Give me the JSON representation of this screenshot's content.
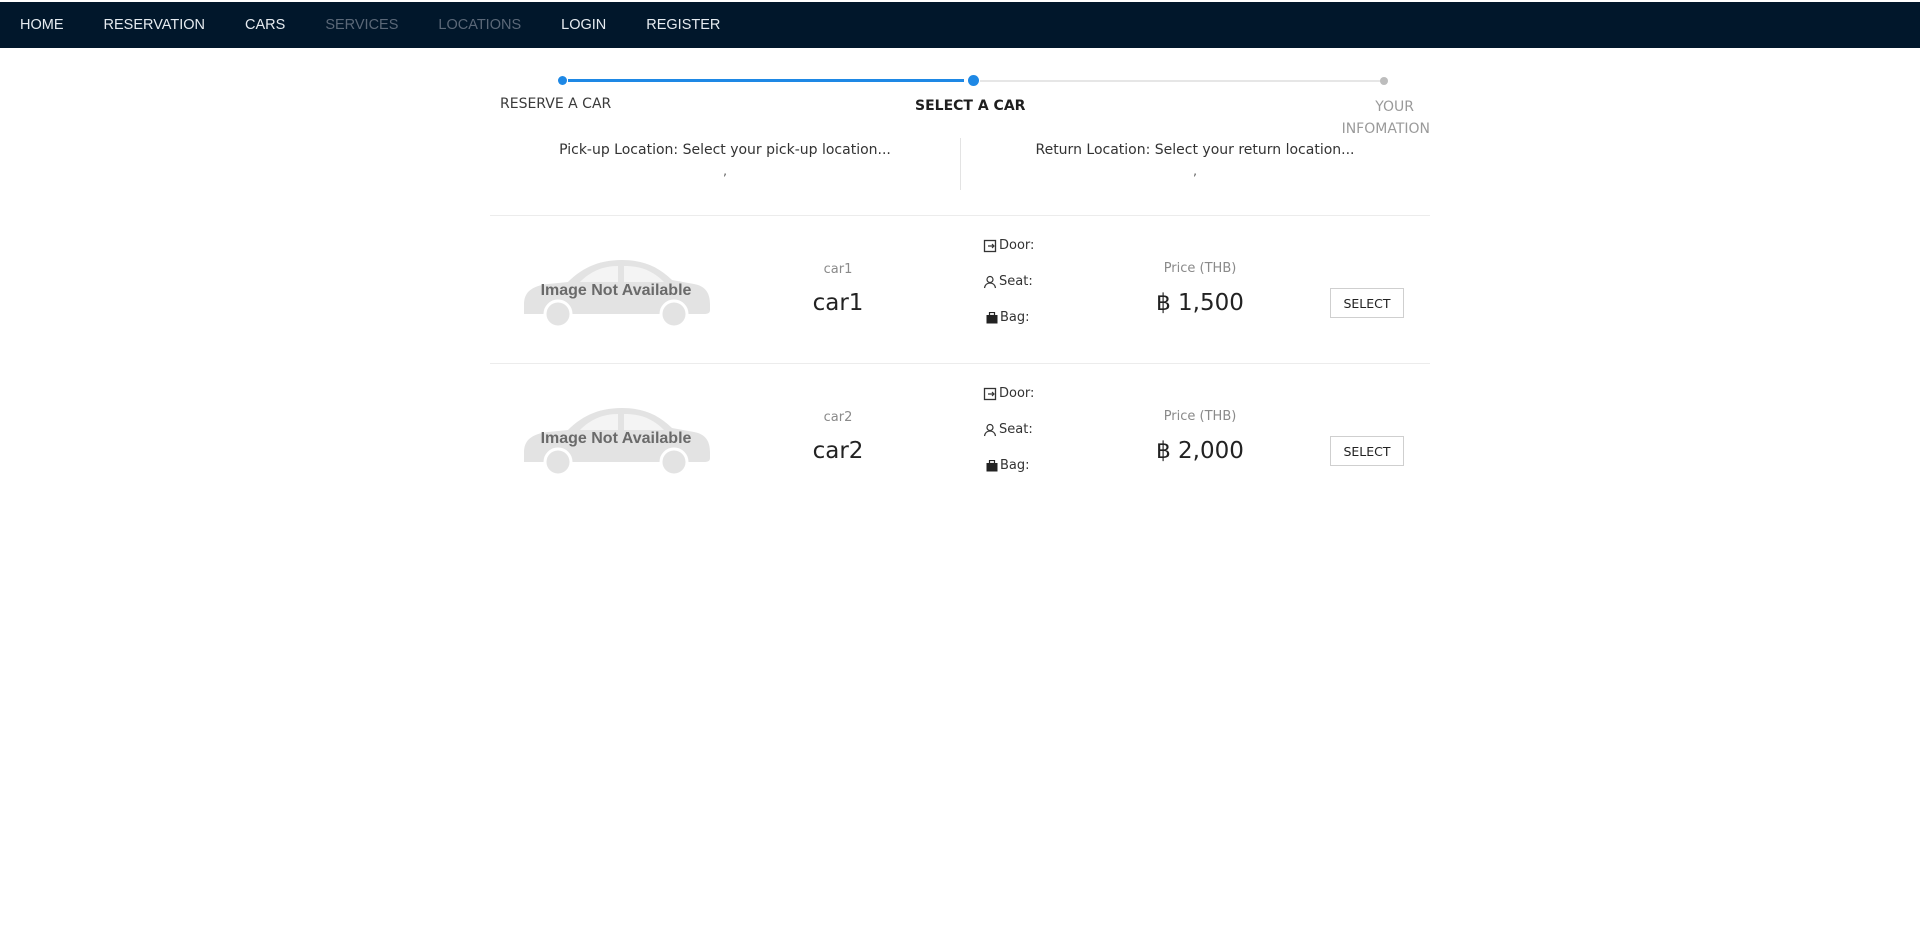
{
  "nav": {
    "items": [
      {
        "label": "HOME"
      },
      {
        "label": "RESERVATION"
      },
      {
        "label": "CARS"
      },
      {
        "label": "SERVICES"
      },
      {
        "label": "LOCATIONS"
      },
      {
        "label": "LOGIN"
      },
      {
        "label": "REGISTER"
      }
    ]
  },
  "stepper": {
    "steps": [
      {
        "label": "RESERVE A CAR",
        "state": "done"
      },
      {
        "label": "SELECT A CAR",
        "state": "active"
      },
      {
        "label_line1": "YOUR",
        "label_line2": "INFOMATION",
        "state": "pending"
      }
    ],
    "active_color": "#1e88e5",
    "pending_color": "#bdbdbd"
  },
  "locations": {
    "pickup": {
      "text": "Pick-up Location: Select your pick-up location...",
      "sub": ","
    },
    "return": {
      "text": "Return Location: Select your return location...",
      "sub": ","
    }
  },
  "cars": [
    {
      "image_text": "Image Not Available",
      "sub": "car1",
      "name": "car1",
      "door_label": "Door:",
      "seat_label": "Seat:",
      "bag_label": "Bag:",
      "price_label": "Price (THB)",
      "price": "฿ 1,500",
      "button": "SELECT"
    },
    {
      "image_text": "Image Not Available",
      "sub": "car2",
      "name": "car2",
      "door_label": "Door:",
      "seat_label": "Seat:",
      "bag_label": "Bag:",
      "price_label": "Price (THB)",
      "price": "฿ 2,000",
      "button": "SELECT"
    }
  ]
}
